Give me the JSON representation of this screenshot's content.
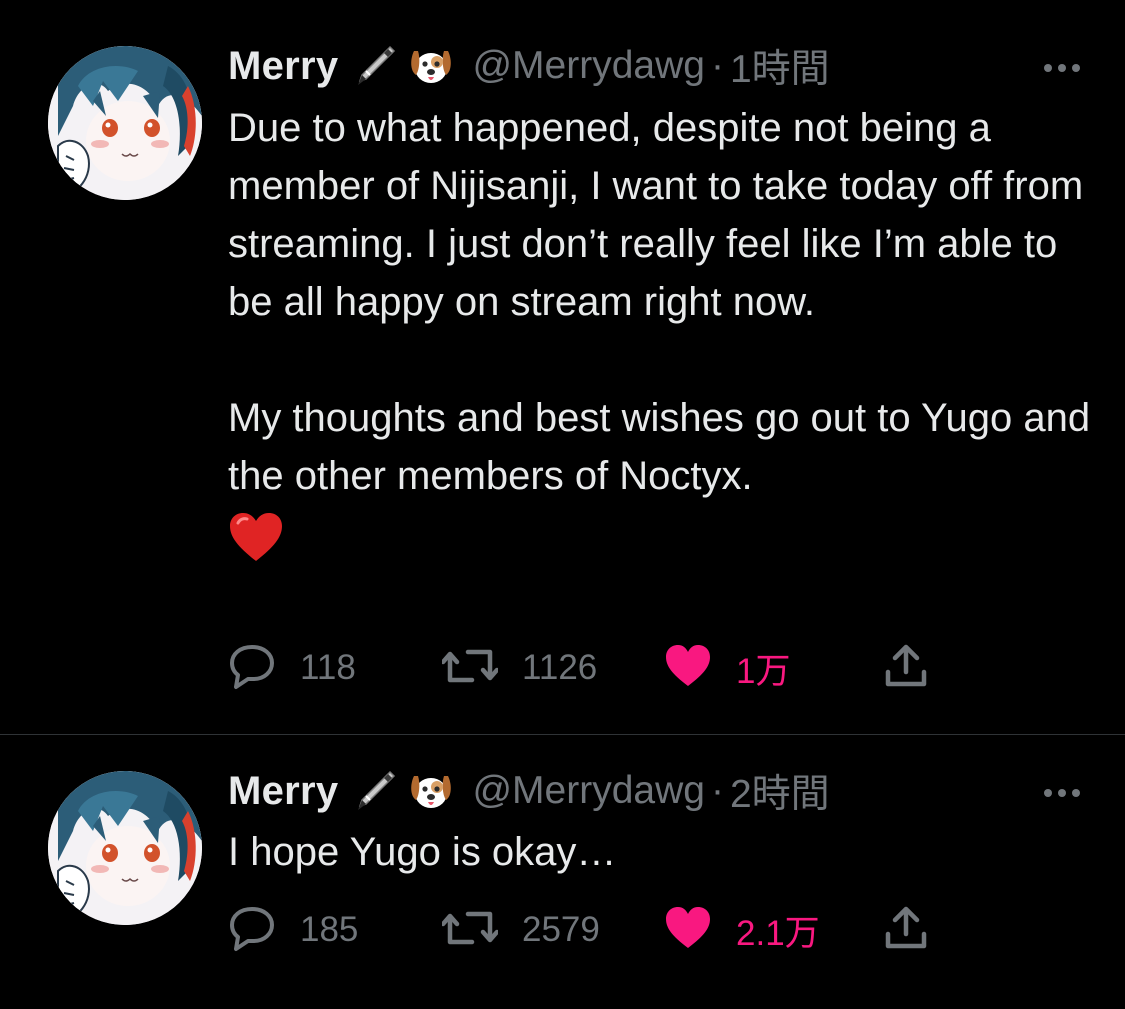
{
  "tweets": [
    {
      "author_name": "Merry",
      "emojis": [
        "pen-icon",
        "dog-face-icon"
      ],
      "handle": "@Merrydawg",
      "separator": "·",
      "time": "1時間",
      "text_paragraphs": [
        "Due to what happened, despite not being a member of Nijisanji, I want to take today off from streaming. I just don’t really feel like I’m able to be all happy on stream right now.",
        "My thoughts and best wishes go out to Yugo and the other members of Noctyx."
      ],
      "trailing_emoji": "red-heart-icon",
      "replies": "118",
      "retweets": "1126",
      "likes": "1万",
      "liked": true
    },
    {
      "author_name": "Merry",
      "emojis": [
        "pen-icon",
        "dog-face-icon"
      ],
      "handle": "@Merrydawg",
      "separator": "·",
      "time": "2時間",
      "text_paragraphs": [
        "I hope Yugo is okay…"
      ],
      "replies": "185",
      "retweets": "2579",
      "likes": "2.1万",
      "liked": true
    }
  ],
  "colors": {
    "background": "#000000",
    "text_primary": "#e7e9ea",
    "text_secondary": "#71767b",
    "like_active": "#f91880",
    "divider": "#2f3336"
  }
}
